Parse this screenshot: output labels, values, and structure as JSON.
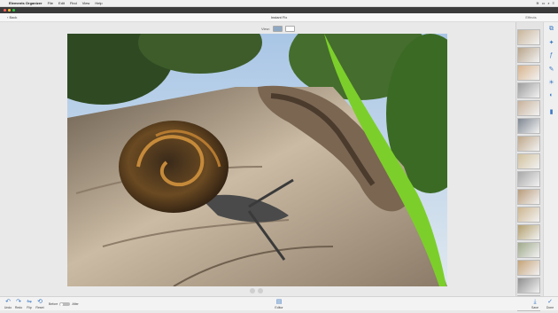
{
  "menubar": {
    "app": "Elements Organizer",
    "items": [
      "File",
      "Edit",
      "Find",
      "View",
      "Help"
    ],
    "status": [
      "",
      "",
      "",
      ""
    ]
  },
  "window": {
    "back_label": "Back",
    "title": "Instant Fix",
    "effects_header": "Effects"
  },
  "view": {
    "label": "View:"
  },
  "effects": {
    "thumb_colors": [
      "#c9b59a",
      "#b9a58b",
      "#d8b48d",
      "#9d9d9d",
      "#c8b29a",
      "#7f8791",
      "#bfa88a",
      "#d1c19d",
      "#a8a8a8",
      "#b99c7a",
      "#cdb68f",
      "#b3a06e",
      "#9fa98a",
      "#c5a377",
      "#8f8f8f",
      "#d2b690"
    ]
  },
  "bottom": {
    "undo": "Undo",
    "redo": "Redo",
    "flip": "Flip",
    "rotate": "Reset",
    "before": "Before",
    "after": "After",
    "editor": "Editor",
    "save": "Save",
    "done": "Done"
  },
  "colors": {
    "accent": "#3b78c4",
    "selected_view": "#8fa8c2"
  }
}
